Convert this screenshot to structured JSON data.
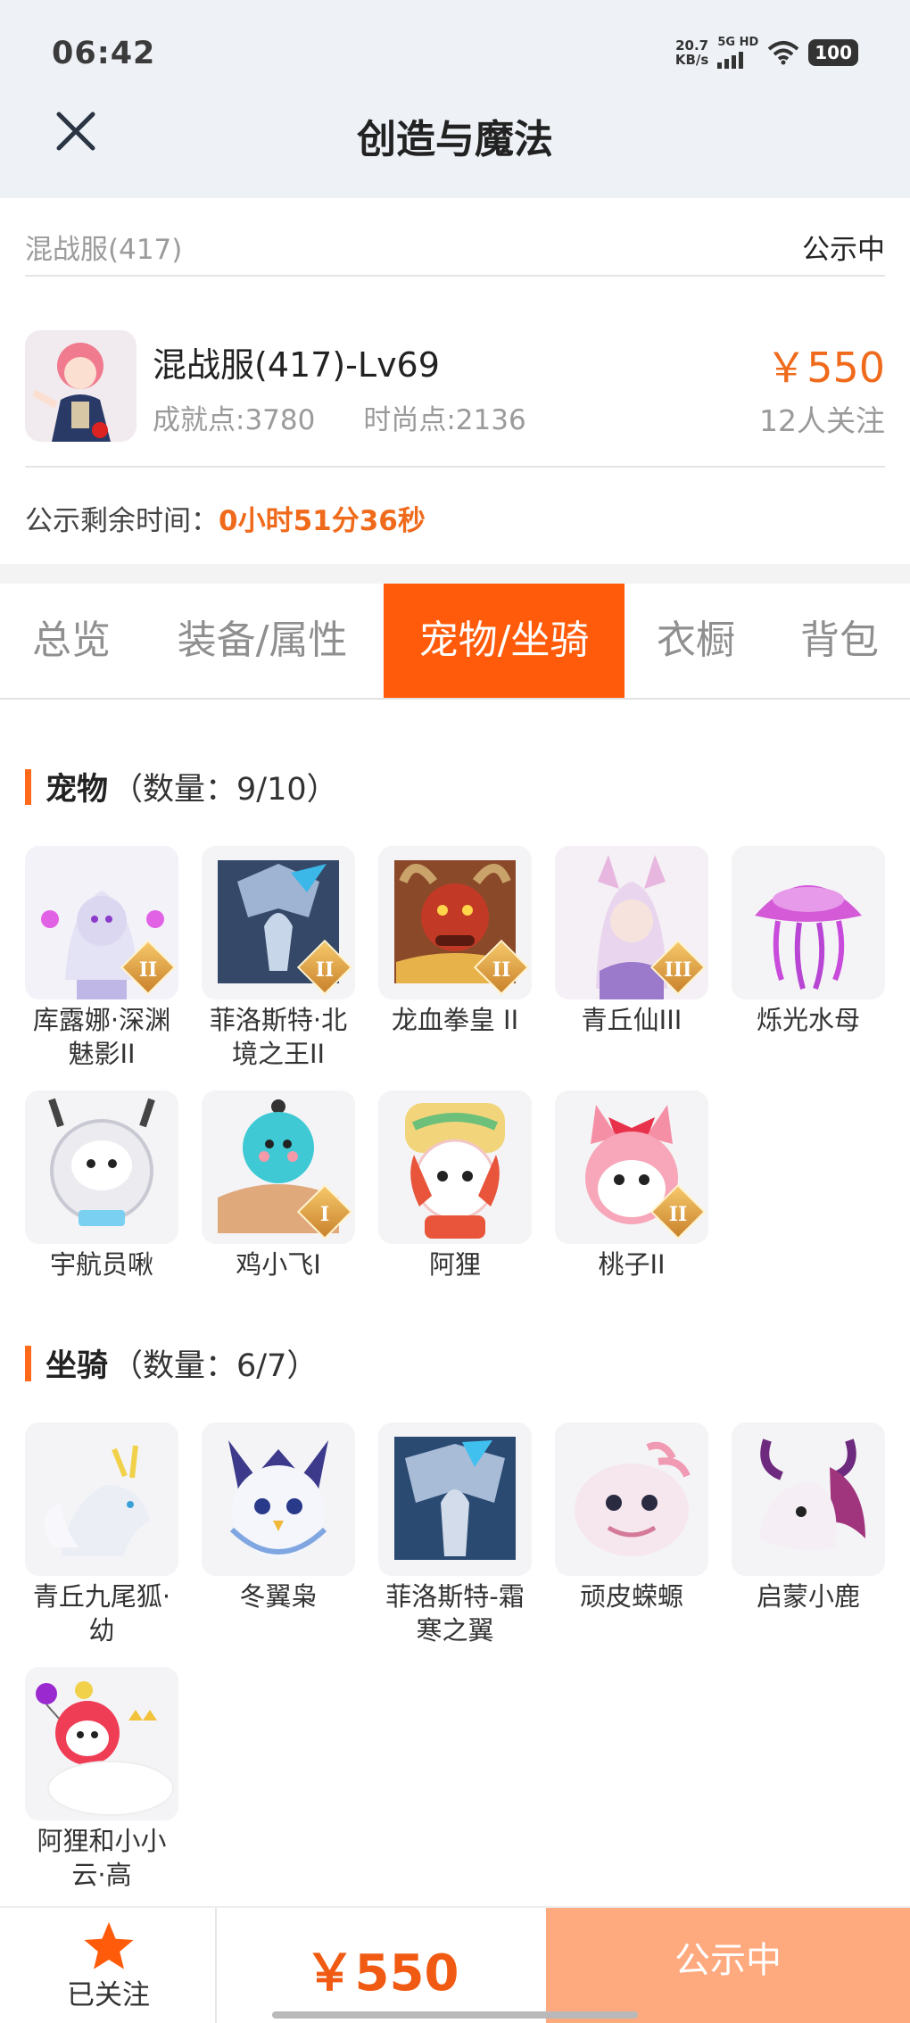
{
  "status": {
    "time": "06:42",
    "net_speed_value": "20.7",
    "net_speed_unit": "KB/s",
    "signal_label": "5G HD",
    "battery": "100"
  },
  "header": {
    "title": "创造与魔法",
    "close_icon": "close-icon"
  },
  "server": {
    "name": "混战服(417)",
    "status": "公示中"
  },
  "listing": {
    "title": "混战服(417)-Lv69",
    "achievement": "成就点:3780",
    "fashion": "时尚点:2136",
    "price": "￥550",
    "followers": "12人关注"
  },
  "remaining": {
    "label": "公示剩余时间：",
    "value": "0小时51分36秒"
  },
  "tabs": [
    {
      "label": "总览"
    },
    {
      "label": "装备/属性"
    },
    {
      "label": "宠物/坐骑",
      "active": true
    },
    {
      "label": "衣橱"
    },
    {
      "label": "背包"
    }
  ],
  "pets": {
    "title": "宠物",
    "count": "（数量：9/10）",
    "items": [
      {
        "name": "库露娜·深渊魅影II",
        "badge": "II"
      },
      {
        "name": "菲洛斯特·北境之王II",
        "badge": "II"
      },
      {
        "name": "龙血拳皇 II",
        "badge": "II"
      },
      {
        "name": "青丘仙III",
        "badge": "III"
      },
      {
        "name": "烁光水母",
        "badge": ""
      },
      {
        "name": "宇航员啾",
        "badge": ""
      },
      {
        "name": "鸡小飞I",
        "badge": "I"
      },
      {
        "name": "阿狸",
        "badge": ""
      },
      {
        "name": "桃子II",
        "badge": "II"
      }
    ]
  },
  "mounts": {
    "title": "坐骑",
    "count": "（数量：6/7）",
    "items": [
      {
        "name": "青丘九尾狐·幼"
      },
      {
        "name": "冬翼枭"
      },
      {
        "name": "菲洛斯特-霜寒之翼"
      },
      {
        "name": "顽皮蝾螈"
      },
      {
        "name": "启蒙小鹿"
      },
      {
        "name": "阿狸和小小云·高"
      }
    ]
  },
  "bottom": {
    "follow_label": "已关注",
    "follow_icon": "star-icon",
    "price": "￥550",
    "cta_label": "公示中"
  },
  "colors": {
    "accent": "#ff5b0a",
    "price": "#f06a1c",
    "cta": "#ffa97f"
  }
}
